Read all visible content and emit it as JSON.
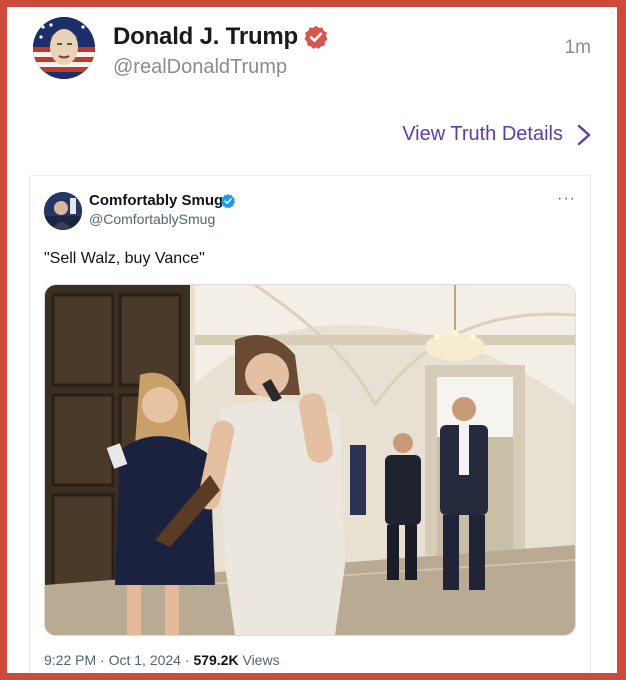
{
  "post": {
    "author_name": "Donald J. Trump",
    "author_handle": "@realDonaldTrump",
    "time_ago": "1m",
    "view_details_label": "View Truth Details"
  },
  "embedded_tweet": {
    "author_name": "Comfortably Smug",
    "author_handle": "@ComfortablySmug",
    "more_label": "···",
    "text": "\"Sell Walz, buy Vance\"",
    "time": "9:22 PM",
    "date": "Oct 1, 2024",
    "views_count": "579.2K",
    "views_label": "Views"
  },
  "colors": {
    "frame_border": "#cf4a3c",
    "truth_verified": "#d9534f",
    "link_purple": "#5b3ea8",
    "x_verified": "#1d9bf0"
  },
  "icons": {
    "verified": "verified-badge-icon",
    "chevron": "chevron-right-icon",
    "more": "more-options-icon"
  }
}
